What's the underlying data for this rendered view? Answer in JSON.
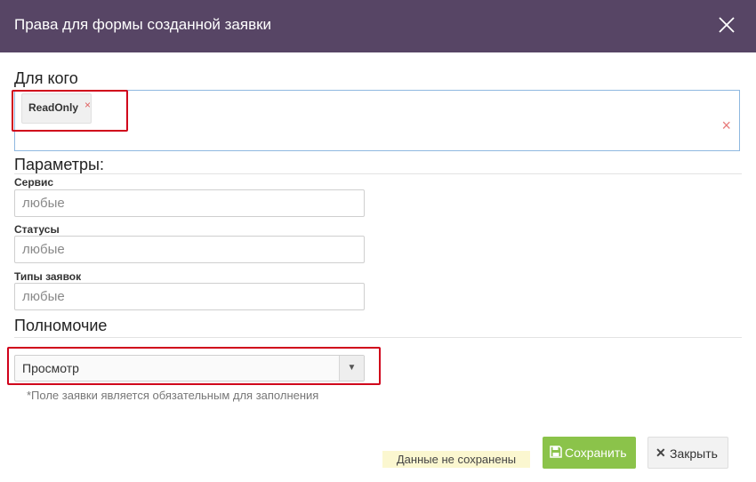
{
  "dialog": {
    "title": "Права для формы созданной заявки",
    "close_icon": "close-icon"
  },
  "who": {
    "heading": "Для кого",
    "tags": [
      {
        "label": "ReadOnly",
        "remove_glyph": "×"
      }
    ],
    "clear_glyph": "×"
  },
  "parameters": {
    "heading": "Параметры:",
    "fields": [
      {
        "label": "Сервис",
        "placeholder": "любые"
      },
      {
        "label": "Статусы",
        "placeholder": "любые"
      },
      {
        "label": "Типы заявок",
        "placeholder": "любые"
      }
    ]
  },
  "authority": {
    "heading": "Полномочие",
    "selected": "Просмотр",
    "arrow_glyph": "▼"
  },
  "required_note": "*Поле заявки является обязательным для заполнения",
  "footer": {
    "unsaved_notice": "Данные не сохранены",
    "save_label": "Сохранить",
    "close_label": "Закрыть",
    "close_glyph": "✕"
  },
  "colors": {
    "header_bg": "#574565",
    "save_bg": "#8bc34a",
    "highlight": "#d0021b",
    "unsaved_bg": "#fbf7d0"
  }
}
